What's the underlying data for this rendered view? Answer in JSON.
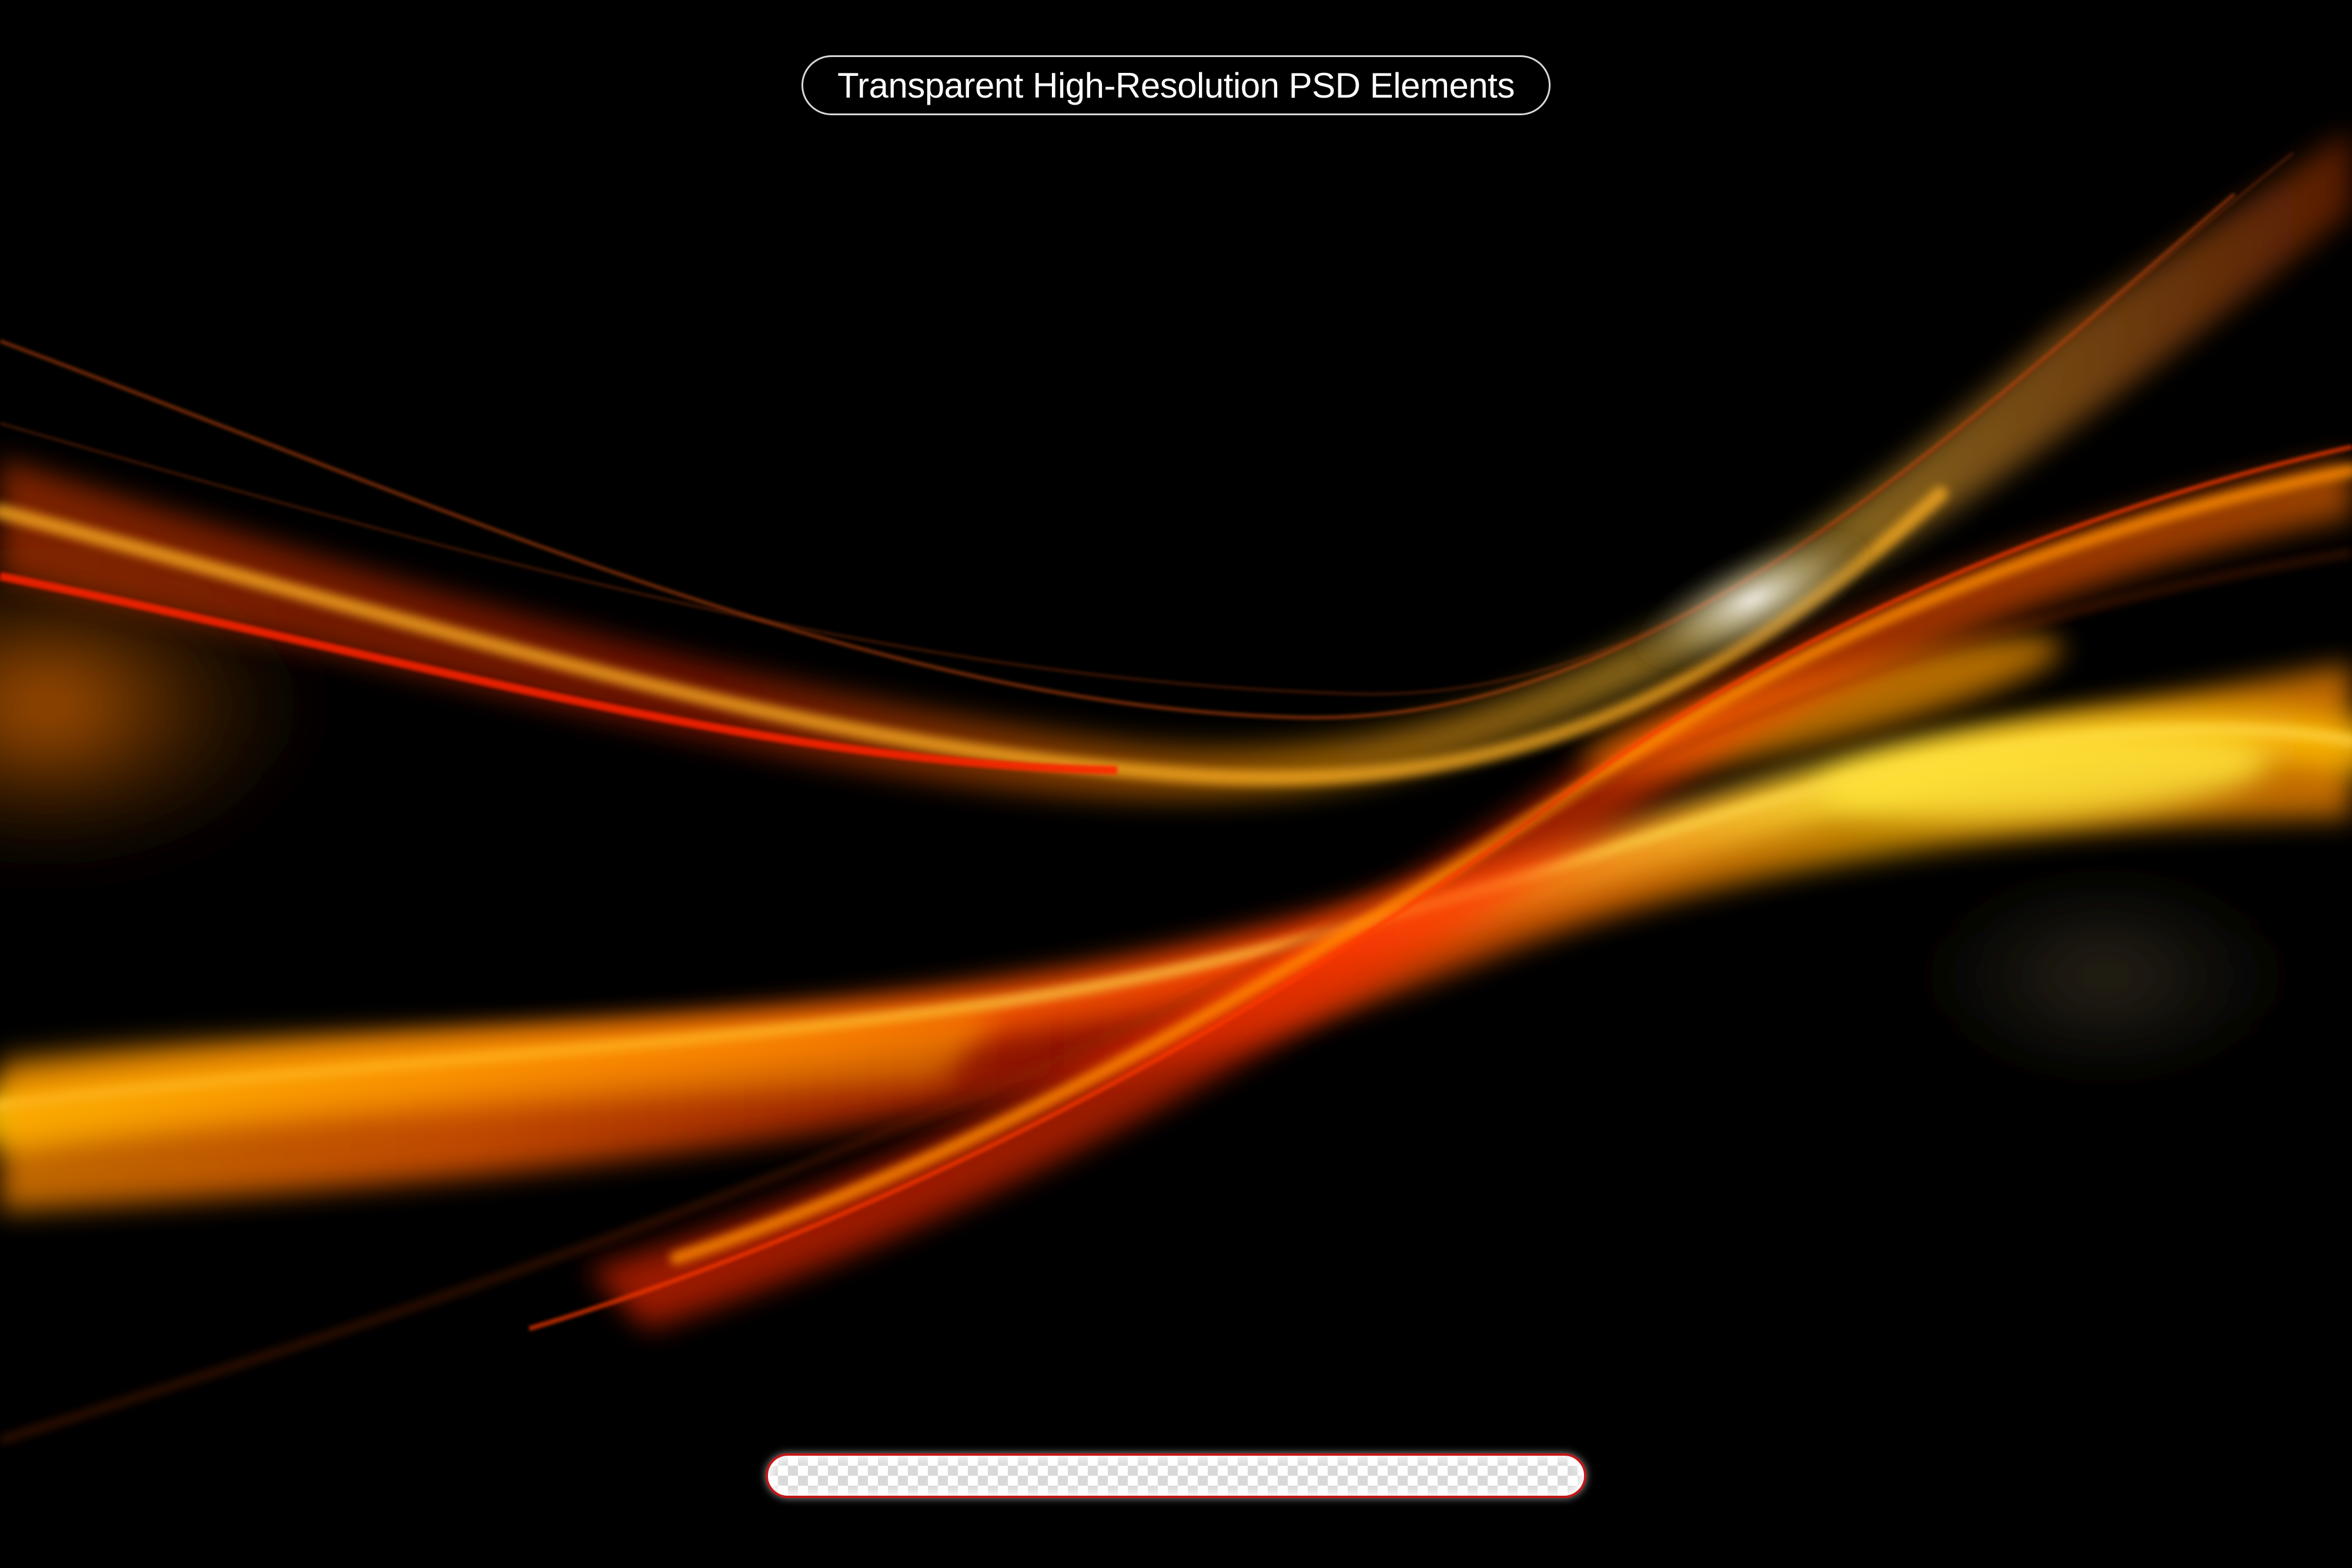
{
  "header": {
    "title": "Transparent High-Resolution PSD Elements"
  },
  "artwork": {
    "subject": "abstract orange flame light waves",
    "background_color": "#000000",
    "accent_colors": [
      "#ff6a00",
      "#ffd200",
      "#c81400",
      "#ffffff"
    ]
  },
  "transparency_bar": {
    "pattern": "checkerboard",
    "border_color": "#c41616"
  }
}
